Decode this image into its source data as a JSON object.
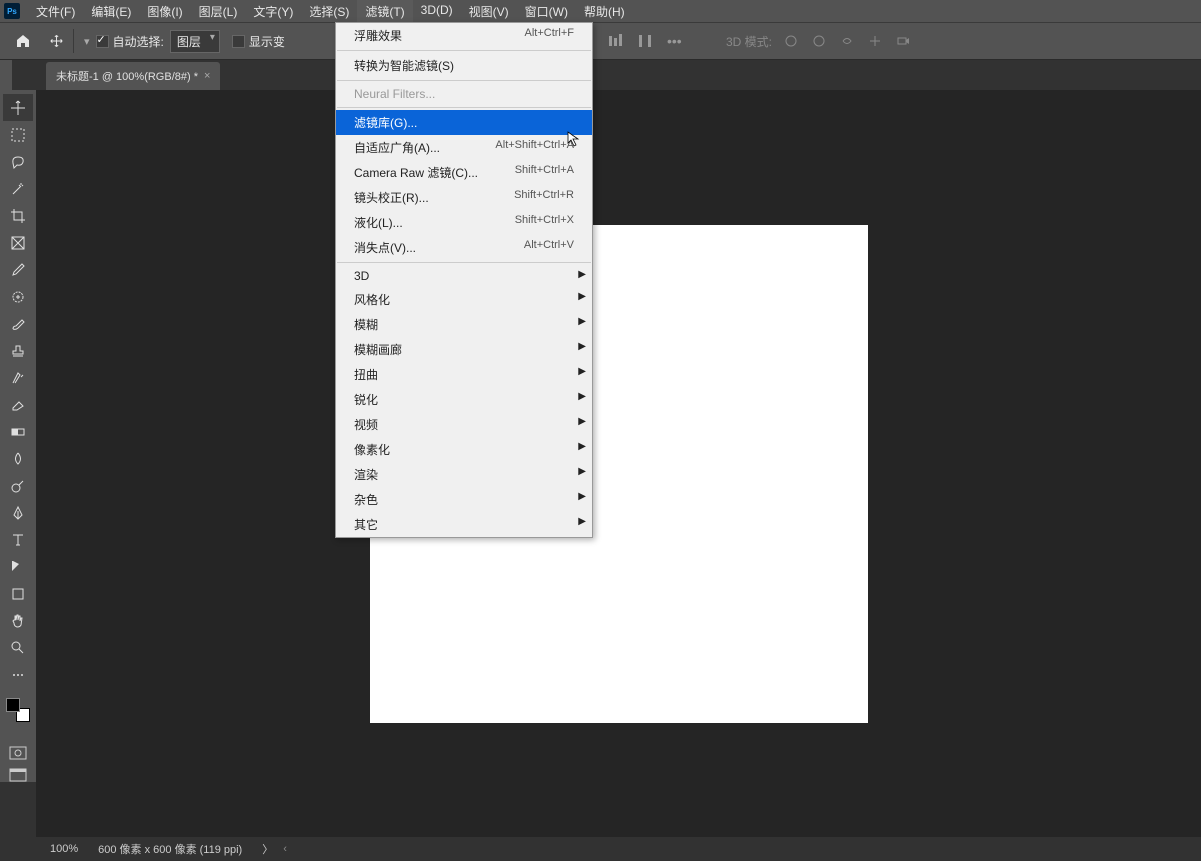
{
  "menubar": {
    "items": [
      "文件(F)",
      "编辑(E)",
      "图像(I)",
      "图层(L)",
      "文字(Y)",
      "选择(S)",
      "滤镜(T)",
      "3D(D)",
      "视图(V)",
      "窗口(W)",
      "帮助(H)"
    ],
    "active_index": 6
  },
  "options": {
    "auto_select": "自动选择:",
    "layer_dropdown": "图层",
    "show_transform": "显示变",
    "mode_3d": "3D 模式:"
  },
  "tab": {
    "title": "未标题-1 @ 100%(RGB/8#) *"
  },
  "filter_menu": {
    "items": [
      {
        "label": "浮雕效果",
        "shortcut": "Alt+Ctrl+F",
        "type": "item"
      },
      {
        "type": "sep"
      },
      {
        "label": "转换为智能滤镜(S)",
        "shortcut": "",
        "type": "item"
      },
      {
        "type": "sep"
      },
      {
        "label": "Neural Filters...",
        "shortcut": "",
        "type": "item",
        "disabled": true
      },
      {
        "type": "sep"
      },
      {
        "label": "滤镜库(G)...",
        "shortcut": "",
        "type": "item",
        "highlighted": true
      },
      {
        "label": "自适应广角(A)...",
        "shortcut": "Alt+Shift+Ctrl+A",
        "type": "item"
      },
      {
        "label": "Camera Raw 滤镜(C)...",
        "shortcut": "Shift+Ctrl+A",
        "type": "item"
      },
      {
        "label": "镜头校正(R)...",
        "shortcut": "Shift+Ctrl+R",
        "type": "item"
      },
      {
        "label": "液化(L)...",
        "shortcut": "Shift+Ctrl+X",
        "type": "item"
      },
      {
        "label": "消失点(V)...",
        "shortcut": "Alt+Ctrl+V",
        "type": "item"
      },
      {
        "type": "sep"
      },
      {
        "label": "3D",
        "shortcut": "",
        "type": "sub"
      },
      {
        "label": "风格化",
        "shortcut": "",
        "type": "sub"
      },
      {
        "label": "模糊",
        "shortcut": "",
        "type": "sub"
      },
      {
        "label": "模糊画廊",
        "shortcut": "",
        "type": "sub"
      },
      {
        "label": "扭曲",
        "shortcut": "",
        "type": "sub"
      },
      {
        "label": "锐化",
        "shortcut": "",
        "type": "sub"
      },
      {
        "label": "视频",
        "shortcut": "",
        "type": "sub"
      },
      {
        "label": "像素化",
        "shortcut": "",
        "type": "sub"
      },
      {
        "label": "渲染",
        "shortcut": "",
        "type": "sub"
      },
      {
        "label": "杂色",
        "shortcut": "",
        "type": "sub"
      },
      {
        "label": "其它",
        "shortcut": "",
        "type": "sub"
      }
    ]
  },
  "statusbar": {
    "zoom": "100%",
    "docinfo": "600 像素 x 600 像素 (119 ppi)",
    "arrow": "〉"
  },
  "tools": [
    "move",
    "marquee",
    "lasso",
    "wand",
    "crop",
    "frame",
    "eyedropper",
    "heal",
    "brush",
    "stamp",
    "history",
    "eraser",
    "gradient",
    "blur",
    "dodge",
    "pen",
    "type",
    "path",
    "shape",
    "hand",
    "zoom",
    "more"
  ]
}
